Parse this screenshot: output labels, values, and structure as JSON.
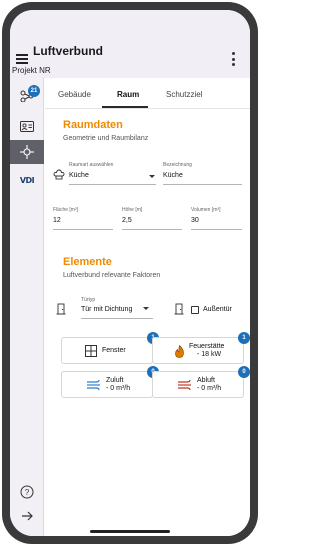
{
  "app": {
    "title": "Luftverbund",
    "project": "Projekt NR"
  },
  "sidebar": {
    "items": [
      {
        "icon": "network-icon",
        "badge": "21"
      },
      {
        "icon": "id-card-icon"
      },
      {
        "icon": "diagram-icon",
        "active": true
      },
      {
        "icon": "vdi-logo-icon",
        "text": "VDI"
      }
    ],
    "bottom": [
      {
        "icon": "help-icon",
        "glyph": "?"
      },
      {
        "icon": "arrow-right-icon",
        "glyph": "→"
      }
    ]
  },
  "tabs": [
    "Gebäude",
    "Raum",
    "Schutzziel"
  ],
  "raumdaten": {
    "title": "Raumdaten",
    "subtitle": "Geometrie und Raumbilanz",
    "raumart_label": "Raumart auswählen",
    "raumart_value": "Küche",
    "bezeichnung_label": "Bezeichnung",
    "bezeichnung_value": "Küche",
    "flaeche_label": "Fläche [m²]",
    "flaeche_value": "12",
    "hoehe_label": "Höhe [m]",
    "hoehe_value": "2,5",
    "volumen_label": "Volumen [m³]",
    "volumen_value": "30"
  },
  "elemente": {
    "title": "Elemente",
    "subtitle": "Luftverbund relevante Faktoren",
    "tuertyp_label": "Türtyp",
    "tuertyp_value": "Tür mit Dichtung",
    "aussentuer_label": "Außentür",
    "cards": [
      {
        "label": "Fenster",
        "badge": "1",
        "icon": "window-icon"
      },
      {
        "label": "Feuerstätte",
        "sublabel": "- 18 kW",
        "badge": "1",
        "icon": "flame-icon"
      },
      {
        "label": "Zuluft",
        "sublabel": "- 0 m³/h",
        "badge": "0",
        "icon": "wind-in-icon"
      },
      {
        "label": "Abluft",
        "sublabel": "- 0 m³/h",
        "badge": "0",
        "icon": "wind-out-icon"
      }
    ]
  },
  "colors": {
    "accent": "#f08a00",
    "badge": "#1e6fb8",
    "appbar": "#f2eef6",
    "sidebar_active": "#5f6068",
    "zuluft_icon": "#2a7fd0",
    "abluft_icon": "#c0392b",
    "flame": "#e07b00"
  }
}
